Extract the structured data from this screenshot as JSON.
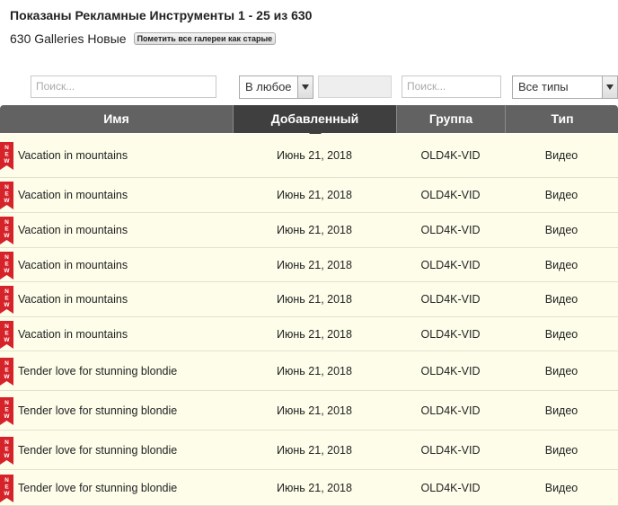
{
  "header": {
    "title": "Показаны Рекламные Инструменты 1 - 25 из 630",
    "subtitle": "630 Galleries Новые",
    "mark_old_button": "Пометить все галереи как старые"
  },
  "filters": {
    "search_name_placeholder": "Поиск...",
    "date_select": "В любое",
    "search_group_placeholder": "Поиск...",
    "type_select": "Все типы"
  },
  "table": {
    "columns": [
      "Имя",
      "Добавленный",
      "Группа",
      "Тип"
    ],
    "new_badge": "NEW",
    "rows": [
      {
        "name": "Vacation in mountains",
        "date": "Июнь 21, 2018",
        "group": "OLD4K-VID",
        "type": "Видео"
      },
      {
        "name": "Vacation in mountains",
        "date": "Июнь 21, 2018",
        "group": "OLD4K-VID",
        "type": "Видео"
      },
      {
        "name": "Vacation in mountains",
        "date": "Июнь 21, 2018",
        "group": "OLD4K-VID",
        "type": "Видео"
      },
      {
        "name": "Vacation in mountains",
        "date": "Июнь 21, 2018",
        "group": "OLD4K-VID",
        "type": "Видео"
      },
      {
        "name": "Vacation in mountains",
        "date": "Июнь 21, 2018",
        "group": "OLD4K-VID",
        "type": "Видео"
      },
      {
        "name": "Vacation in mountains",
        "date": "Июнь 21, 2018",
        "group": "OLD4K-VID",
        "type": "Видео"
      },
      {
        "name": "Tender love for stunning blondie",
        "date": "Июнь 21, 2018",
        "group": "OLD4K-VID",
        "type": "Видео"
      },
      {
        "name": "Tender love for stunning blondie",
        "date": "Июнь 21, 2018",
        "group": "OLD4K-VID",
        "type": "Видео"
      },
      {
        "name": "Tender love for stunning blondie",
        "date": "Июнь 21, 2018",
        "group": "OLD4K-VID",
        "type": "Видео"
      },
      {
        "name": "Tender love for stunning blondie",
        "date": "Июнь 21, 2018",
        "group": "OLD4K-VID",
        "type": "Видео"
      }
    ]
  },
  "colors": {
    "header_bg": "#626262",
    "header_active_bg": "#3f3f3f",
    "row_bg": "#fdfdea",
    "new_badge": "#d6232a"
  }
}
